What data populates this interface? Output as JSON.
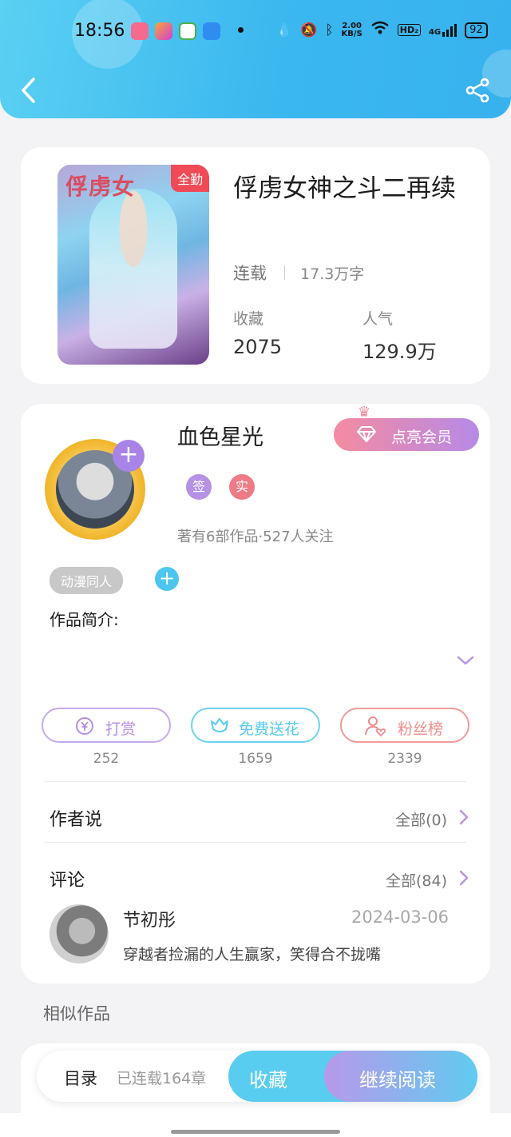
{
  "status_bar": {
    "time": "18:56",
    "net_speed_top": "2.00",
    "net_speed_bottom": "KB/S",
    "hd_label": "HD₂",
    "signal_label": "4G",
    "battery": "92"
  },
  "book": {
    "cover_text": "俘虏女",
    "cover_badge": "全勤",
    "title": "俘虏女神之斗二再续",
    "status": "连载",
    "word_count": "17.3万字",
    "favorites_label": "收藏",
    "favorites_value": "2075",
    "popularity_label": "人气",
    "popularity_value": "129.9万"
  },
  "author": {
    "name": "血色星光",
    "vip_button": "点亮会员",
    "tag_signed": "签",
    "tag_verified": "实",
    "meta": "著有6部作品·527人关注",
    "genre_tag": "动漫同人",
    "intro_label": "作品简介:"
  },
  "actions": [
    {
      "label": "打赏",
      "count": "252",
      "color": "#b48de6"
    },
    {
      "label": "免费送花",
      "count": "1659",
      "color": "#56cbef"
    },
    {
      "label": "粉丝榜",
      "count": "2339",
      "color": "#ef8c8c"
    }
  ],
  "author_says": {
    "title": "作者说",
    "link": "全部(0)"
  },
  "comments": {
    "title": "评论",
    "link": "全部(84)",
    "first": {
      "user": "节初彤",
      "date": "2024-03-06",
      "text": "穿越者捡漏的人生赢家，笑得合不拢嘴"
    }
  },
  "similar": {
    "title": "相似作品"
  },
  "bottom_bar": {
    "toc": "目录",
    "chapters": "已连载164章",
    "favorite": "收藏",
    "continue": "继续阅读"
  },
  "colors": {
    "header": "#3bb7ef",
    "accent_purple": "#a784e6",
    "accent_blue": "#56cbef",
    "accent_red": "#ef8c8c"
  }
}
